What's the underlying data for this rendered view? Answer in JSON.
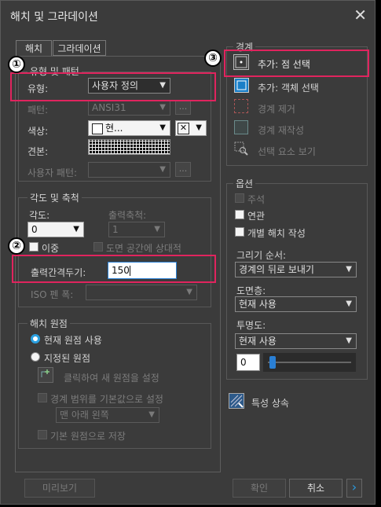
{
  "title": "해치 및 그라데이션",
  "tabs": {
    "hatch": "해치",
    "gradient": "그라데이션"
  },
  "type_pattern": {
    "group_title": "유형 및 패턴",
    "type_label": "유형:",
    "type_value": "사용자 정의",
    "pattern_label": "패턴:",
    "pattern_value": "ANSI31",
    "color_label": "색상:",
    "color_value": "현...",
    "swatch_label": "견본:",
    "custom_pattern_label": "사용자 패턴:",
    "ellipsis": "..."
  },
  "angle_scale": {
    "group_title": "각도 및 축척",
    "angle_label": "각도:",
    "angle_value": "0",
    "scale_label": "출력축척:",
    "scale_value": "1",
    "double_label": "이중",
    "relative_label": "도면 공간에 상대적",
    "spacing_label": "출력간격두기:",
    "spacing_value": "150",
    "iso_label": "ISO 펜 폭:"
  },
  "origin": {
    "group_title": "해치 원점",
    "current_origin": "현재 원점 사용",
    "specified_origin": "지정된 원점",
    "click_set": "클릭하여 새 원점을 설정",
    "default_extents": "경계 범위를 기본값으로 설정",
    "position_value": "맨 아래 왼쪽",
    "store_default": "기본 원점으로 저장"
  },
  "boundary": {
    "group_title": "경계",
    "add_pick": "추가: 점 선택",
    "add_select": "추가: 객체 선택",
    "remove": "경계 제거",
    "recreate": "경계 재작성",
    "view_selection": "선택 요소 보기"
  },
  "options": {
    "group_title": "옵션",
    "annotative": "주석",
    "associative": "연관",
    "separate": "개별 해치 작성",
    "draw_order_label": "그리기 순서:",
    "draw_order_value": "경계의 뒤로 보내기",
    "layer_label": "도면층:",
    "layer_value": "현재 사용",
    "transparency_label": "투명도:",
    "transparency_mode": "현재 사용",
    "transparency_value": "0",
    "inherit": "특성 상속"
  },
  "buttons": {
    "preview": "미리보기",
    "ok": "확인",
    "cancel": "취소",
    "expand": "›"
  },
  "badges": {
    "one": "①",
    "two": "②",
    "three": "③"
  }
}
